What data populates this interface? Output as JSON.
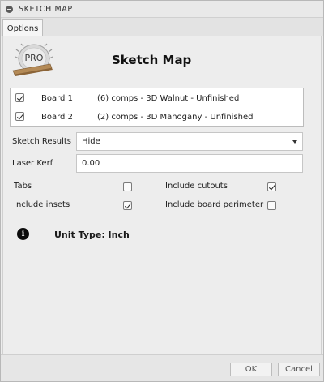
{
  "window": {
    "title": "SKETCH MAP"
  },
  "tabs": [
    {
      "label": "Options",
      "active": true
    }
  ],
  "header": {
    "logo_text": "PRO",
    "title": "Sketch Map"
  },
  "boards": [
    {
      "name": "Board 1",
      "description": "(6) comps - 3D Walnut - Unfinished",
      "checked": true
    },
    {
      "name": "Board 2",
      "description": "(2) comps - 3D Mahogany - Unfinished",
      "checked": true
    }
  ],
  "sketch_results": {
    "label": "Sketch Results",
    "value": "Hide"
  },
  "laser_kerf": {
    "label": "Laser Kerf",
    "value": "0.00"
  },
  "options": {
    "tabs": {
      "label": "Tabs",
      "checked": false
    },
    "include_cutouts": {
      "label": "Include cutouts",
      "checked": true
    },
    "include_insets": {
      "label": "Include insets",
      "checked": true
    },
    "include_board_perimeter": {
      "label": "Include board perimeter",
      "checked": false
    }
  },
  "info": {
    "icon": "info-icon",
    "glyph": "i",
    "text": "Unit Type: Inch"
  },
  "footer": {
    "ok_label": "OK",
    "cancel_label": "Cancel"
  }
}
